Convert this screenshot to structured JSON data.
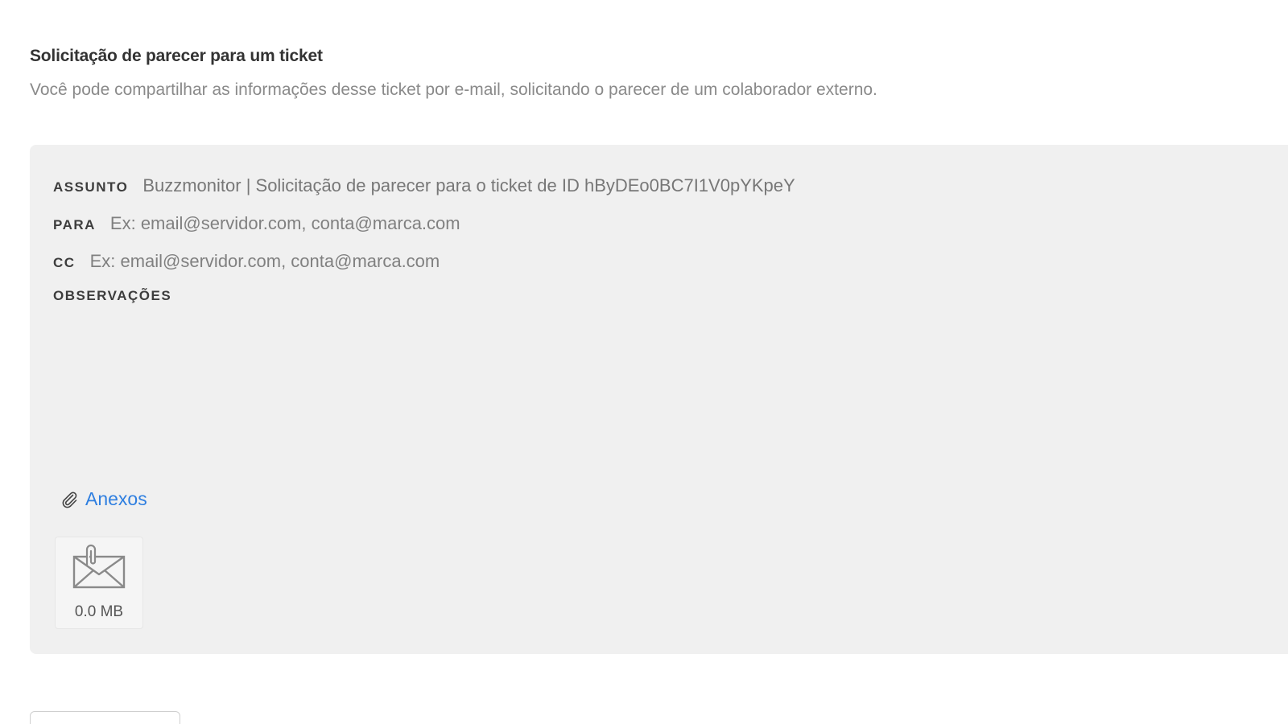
{
  "header": {
    "title": "Solicitação de parecer para um ticket",
    "subtitle": "Você pode compartilhar as informações desse ticket por e-mail, solicitando o parecer de um colaborador externo."
  },
  "form": {
    "subject_label": "ASSUNTO",
    "subject_value": "Buzzmonitor | Solicitação de parecer para o ticket de ID hByDEo0BC7I1V0pYKpeY",
    "to_label": "PARA",
    "to_placeholder": "Ex: email@servidor.com, conta@marca.com",
    "cc_label": "CC",
    "cc_placeholder": "Ex: email@servidor.com, conta@marca.com",
    "notes_label": "OBSERVAÇÕES",
    "notes_value": ""
  },
  "attachments": {
    "link_label": "Anexos",
    "link_icon": "paperclip-icon",
    "file_icon": "envelope-attachment-icon",
    "file_size": "0.0 MB"
  },
  "colors": {
    "panel_background": "#f0f0f0",
    "link": "#2f7fe0",
    "label": "#3d3d3d",
    "muted_text": "#8a8a8a"
  }
}
